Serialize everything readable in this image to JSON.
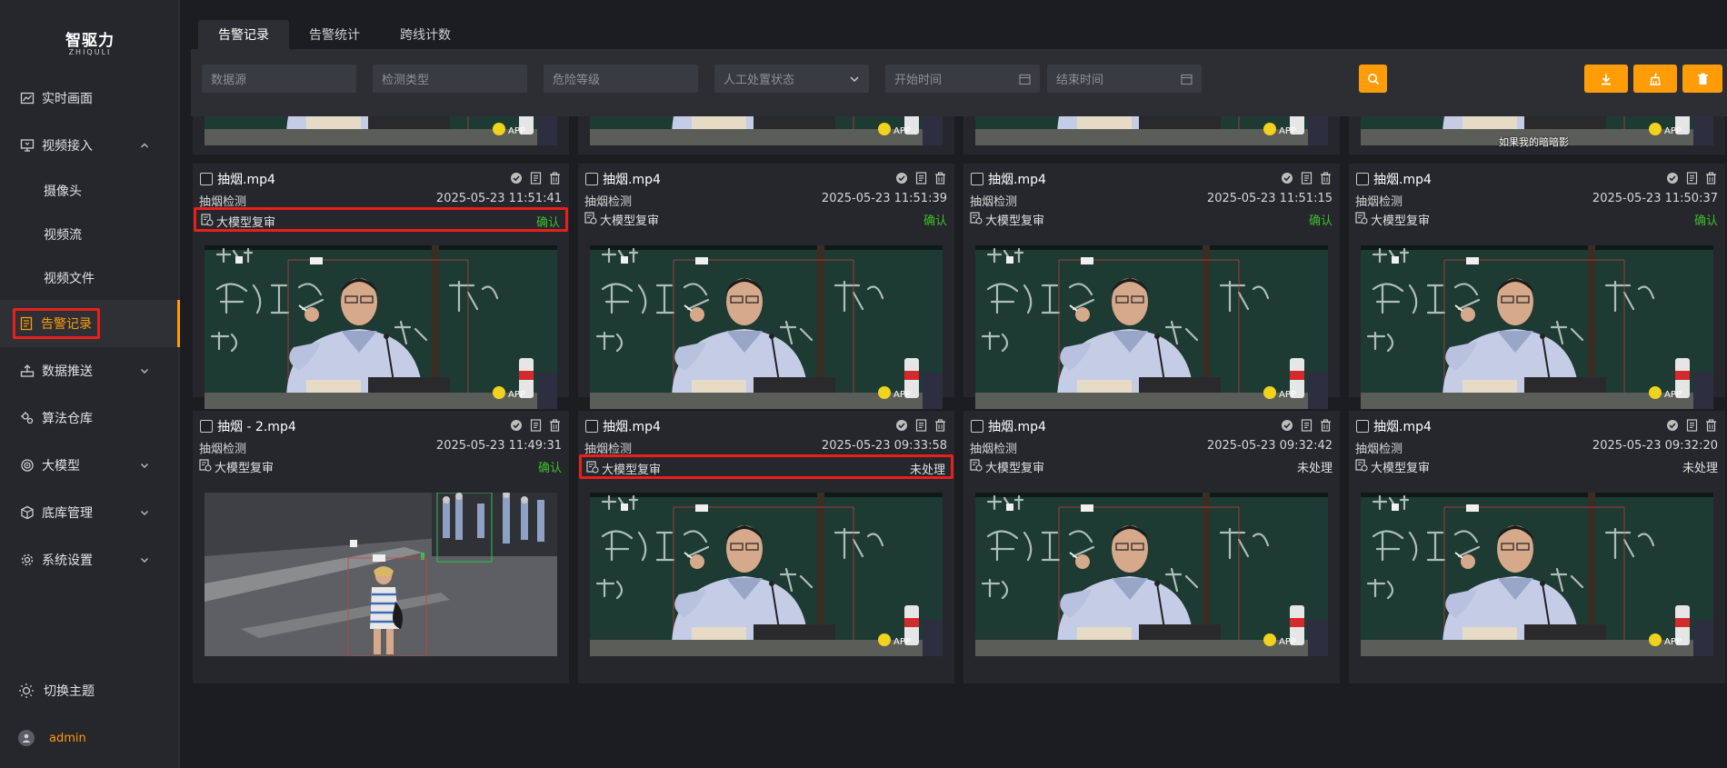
{
  "app": {
    "logo_cn": "智驱力",
    "logo_en": "ZHIQULI"
  },
  "sidebar": {
    "items": [
      {
        "label": "实时画面",
        "icon": "chart-line-icon"
      },
      {
        "label": "视频接入",
        "icon": "monitor-icon"
      },
      {
        "label": "摄像头"
      },
      {
        "label": "视频流"
      },
      {
        "label": "视频文件"
      },
      {
        "label": "告警记录",
        "icon": "document-list-icon"
      },
      {
        "label": "数据推送",
        "icon": "upload-icon"
      },
      {
        "label": "算法仓库",
        "icon": "gears-icon"
      },
      {
        "label": "大模型",
        "icon": "target-icon"
      },
      {
        "label": "底库管理",
        "icon": "box-icon"
      },
      {
        "label": "系统设置",
        "icon": "gear-icon"
      }
    ],
    "theme_label": "切换主题",
    "user": "admin"
  },
  "tabs": [
    {
      "label": "告警记录",
      "active": true
    },
    {
      "label": "告警统计",
      "active": false
    },
    {
      "label": "跨线计数",
      "active": false
    }
  ],
  "filters": {
    "source_placeholder": "数据源",
    "type_placeholder": "检测类型",
    "level_placeholder": "危险等级",
    "status_placeholder": "人工处置状态",
    "start_placeholder": "开始时间",
    "end_placeholder": "结束时间"
  },
  "colors": {
    "accent": "#ff9c07",
    "highlight": "#e8201b",
    "confirm": "#3fbe2c"
  },
  "top_partial_caption": "如果我的暗暗影",
  "cards": [
    {
      "file": "抽烟.mp4",
      "type": "抽烟检测",
      "time": "2025-05-23 11:51:41",
      "review": "大模型复审",
      "status": "确认",
      "scene": "classroom"
    },
    {
      "file": "抽烟.mp4",
      "type": "抽烟检测",
      "time": "2025-05-23 11:51:39",
      "review": "大模型复审",
      "status": "确认",
      "scene": "classroom"
    },
    {
      "file": "抽烟.mp4",
      "type": "抽烟检测",
      "time": "2025-05-23 11:51:15",
      "review": "大模型复审",
      "status": "确认",
      "scene": "classroom"
    },
    {
      "file": "抽烟.mp4",
      "type": "抽烟检测",
      "time": "2025-05-23 11:50:37",
      "review": "大模型复审",
      "status": "确认",
      "scene": "classroom"
    },
    {
      "file": "抽烟 - 2.mp4",
      "type": "抽烟检测",
      "time": "2025-05-23 11:49:31",
      "review": "大模型复审",
      "status": "确认",
      "scene": "street"
    },
    {
      "file": "抽烟.mp4",
      "type": "抽烟检测",
      "time": "2025-05-23 09:33:58",
      "review": "大模型复审",
      "status": "未处理",
      "scene": "classroom"
    },
    {
      "file": "抽烟.mp4",
      "type": "抽烟检测",
      "time": "2025-05-23 09:32:42",
      "review": "大模型复审",
      "status": "未处理",
      "scene": "classroom"
    },
    {
      "file": "抽烟.mp4",
      "type": "抽烟检测",
      "time": "2025-05-23 09:32:20",
      "review": "大模型复审",
      "status": "未处理",
      "scene": "classroom"
    }
  ]
}
